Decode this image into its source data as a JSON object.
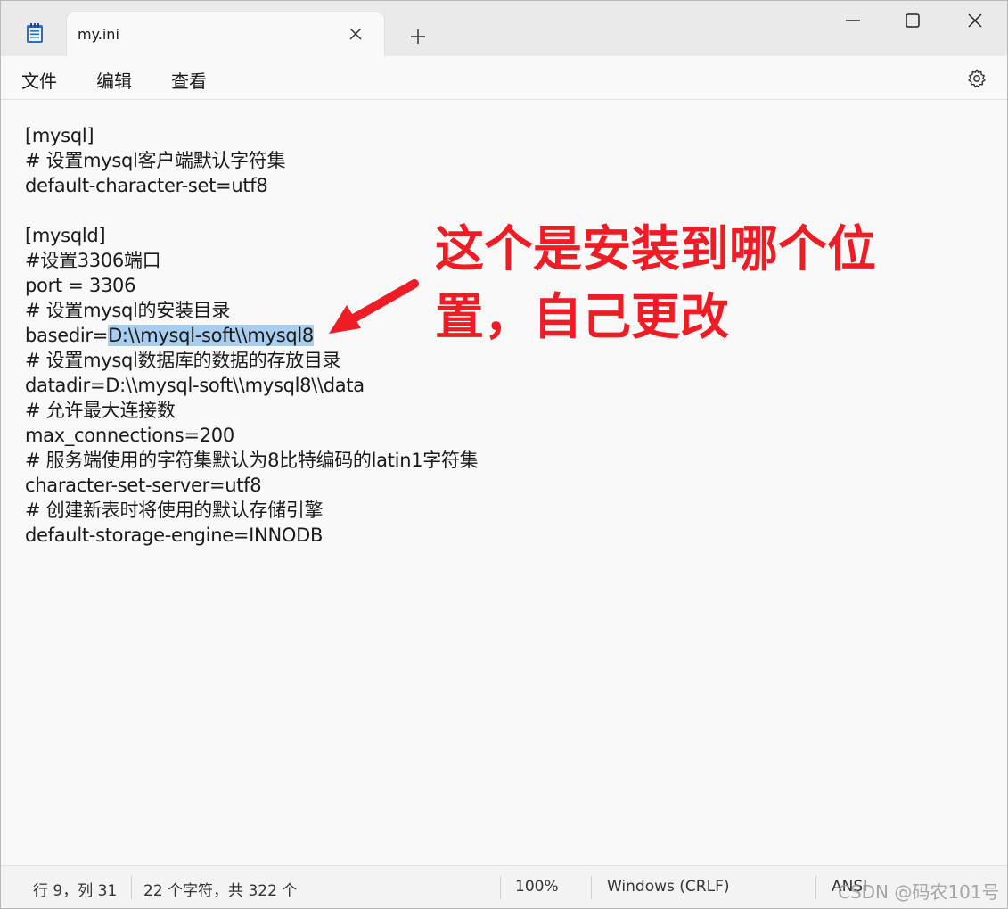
{
  "tab": {
    "title": "my.ini"
  },
  "menu": {
    "file": "文件",
    "edit": "编辑",
    "view": "查看"
  },
  "editor": {
    "lines": [
      "[mysql]",
      "# 设置mysql客户端默认字符集",
      "default-character-set=utf8",
      "",
      "[mysqld]",
      "#设置3306端口",
      "port = 3306",
      "# 设置mysql的安装目录",
      "basedir=",
      "# 设置mysql数据库的数据的存放目录",
      "datadir=D:\\\\mysql-soft\\\\mysql8\\\\data",
      "# 允许最大连接数",
      "max_connections=200",
      "# 服务端使用的字符集默认为8比特编码的latin1字符集",
      "character-set-server=utf8",
      "# 创建新表时将使用的默认存储引擎",
      "default-storage-engine=INNODB"
    ],
    "selected_text": "D:\\\\mysql-soft\\\\mysql8",
    "selection_color": "#a9cdee"
  },
  "annotation": {
    "line1": "这个是安装到哪个位",
    "line2": "置，自己更改",
    "color": "#ee1c24"
  },
  "status": {
    "position": "行 9，列 31",
    "chars": "22 个字符，共 322 个",
    "zoom": "100%",
    "line_ending": "Windows (CRLF)",
    "encoding": "ANSI"
  },
  "watermark": "CSDN @码农101号"
}
